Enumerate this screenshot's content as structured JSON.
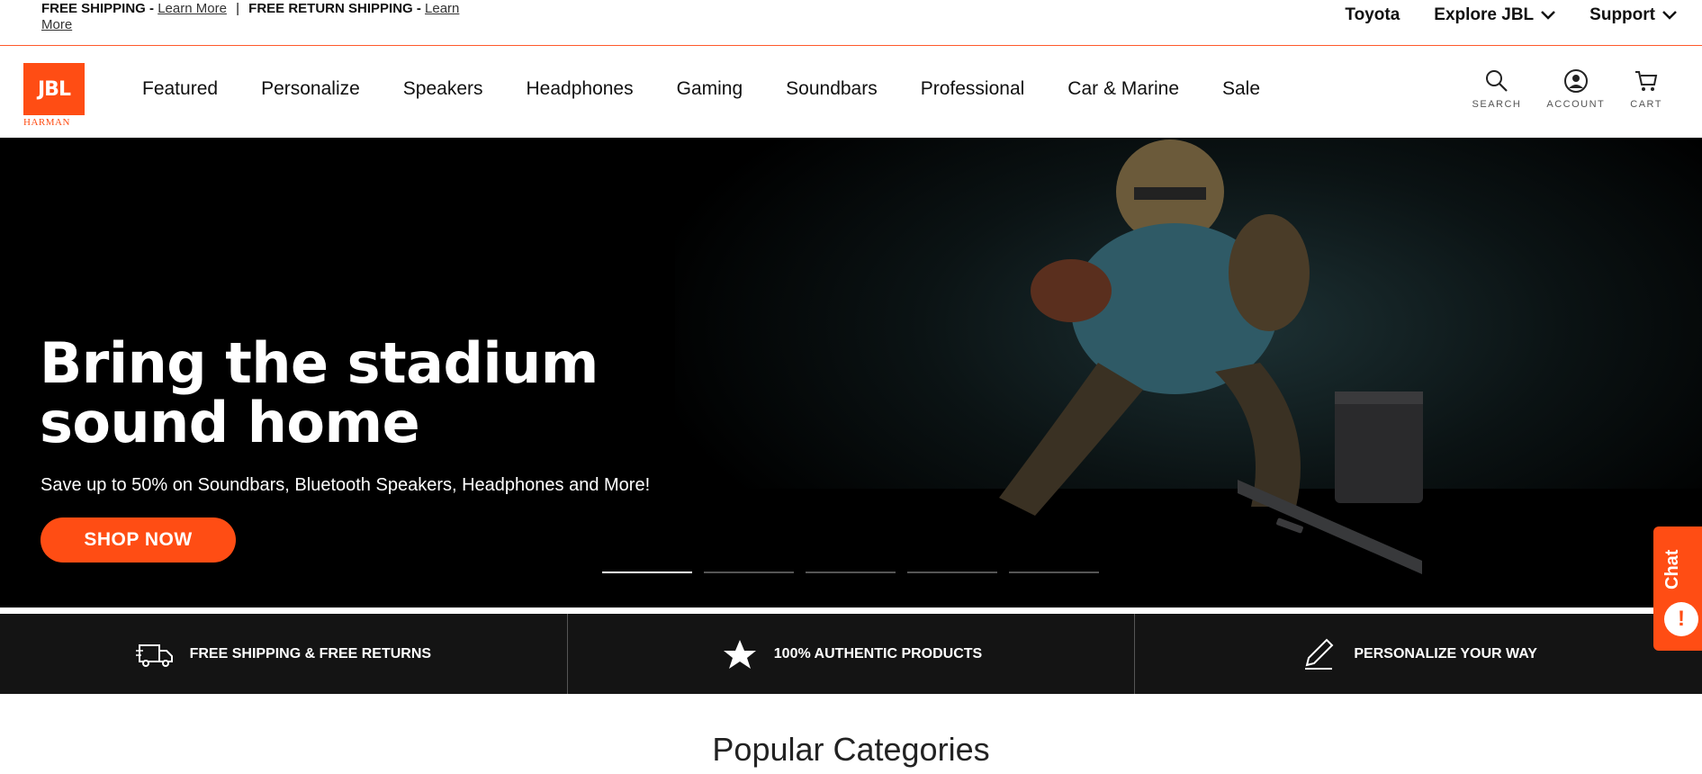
{
  "promo": {
    "shipping_label": "FREE SHIPPING -",
    "shipping_link": "Learn More",
    "separator": "|",
    "returns_label": "FREE RETURN SHIPPING -",
    "returns_link": "Learn More"
  },
  "utility": {
    "toyota": "Toyota",
    "explore": "Explore JBL",
    "support": "Support"
  },
  "brand": {
    "logo_text": "JBL",
    "sub_text": "HARMAN",
    "color": "#ff4d14"
  },
  "menu": [
    "Featured",
    "Personalize",
    "Speakers",
    "Headphones",
    "Gaming",
    "Soundbars",
    "Professional",
    "Car & Marine",
    "Sale"
  ],
  "actions": {
    "search": "SEARCH",
    "account": "ACCOUNT",
    "cart": "CART"
  },
  "hero": {
    "headline_line1": "Bring the stadium",
    "headline_line2": "sound home",
    "subtext": "Save up to 50% on Soundbars, Bluetooth Speakers, Headphones and More!",
    "cta": "SHOP NOW",
    "slides_active": 1
  },
  "features": [
    {
      "label": "FREE SHIPPING & FREE RETURNS",
      "icon": "truck-icon"
    },
    {
      "label": "100% AUTHENTIC PRODUCTS",
      "icon": "star-icon"
    },
    {
      "label": "PERSONALIZE YOUR WAY",
      "icon": "pen-icon"
    }
  ],
  "section_title": "Popular Categories",
  "chat": {
    "label": "Chat"
  }
}
